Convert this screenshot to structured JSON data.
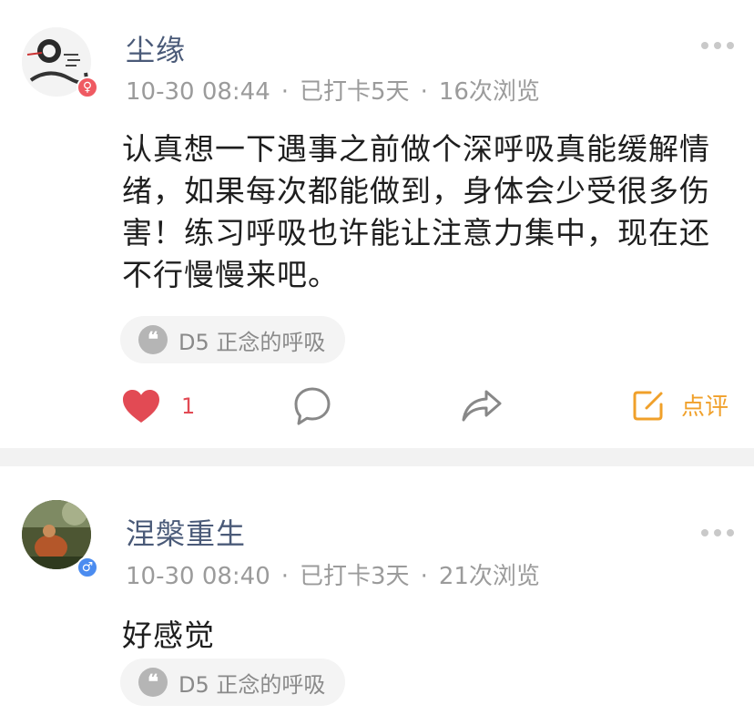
{
  "posts": [
    {
      "username": "尘缘",
      "time": "10-30 08:44",
      "checkin": "已打卡5天",
      "views": "16次浏览",
      "content": "认真想一下遇事之前做个深呼吸真能缓解情绪，如果每次都能做到，身体会少受很多伤害！练习呼吸也许能让注意力集中，现在还不行慢慢来吧。",
      "tag": "D5 正念的呼吸",
      "likes": "1",
      "review_label": "点评",
      "separator": "·"
    },
    {
      "username": "涅槃重生",
      "time": "10-30 08:40",
      "checkin": "已打卡3天",
      "views": "21次浏览",
      "content": "好感觉",
      "tag": "D5 正念的呼吸",
      "separator": "·"
    }
  ],
  "icons": {
    "quote": "❝",
    "female": "♀",
    "male": "♂"
  },
  "colors": {
    "username": "#4a5a78",
    "meta": "#9b9b9b",
    "like": "#e24a54",
    "review": "#f0a02a",
    "female_badge": "#ef5a62",
    "male_badge": "#4b8cf0"
  }
}
